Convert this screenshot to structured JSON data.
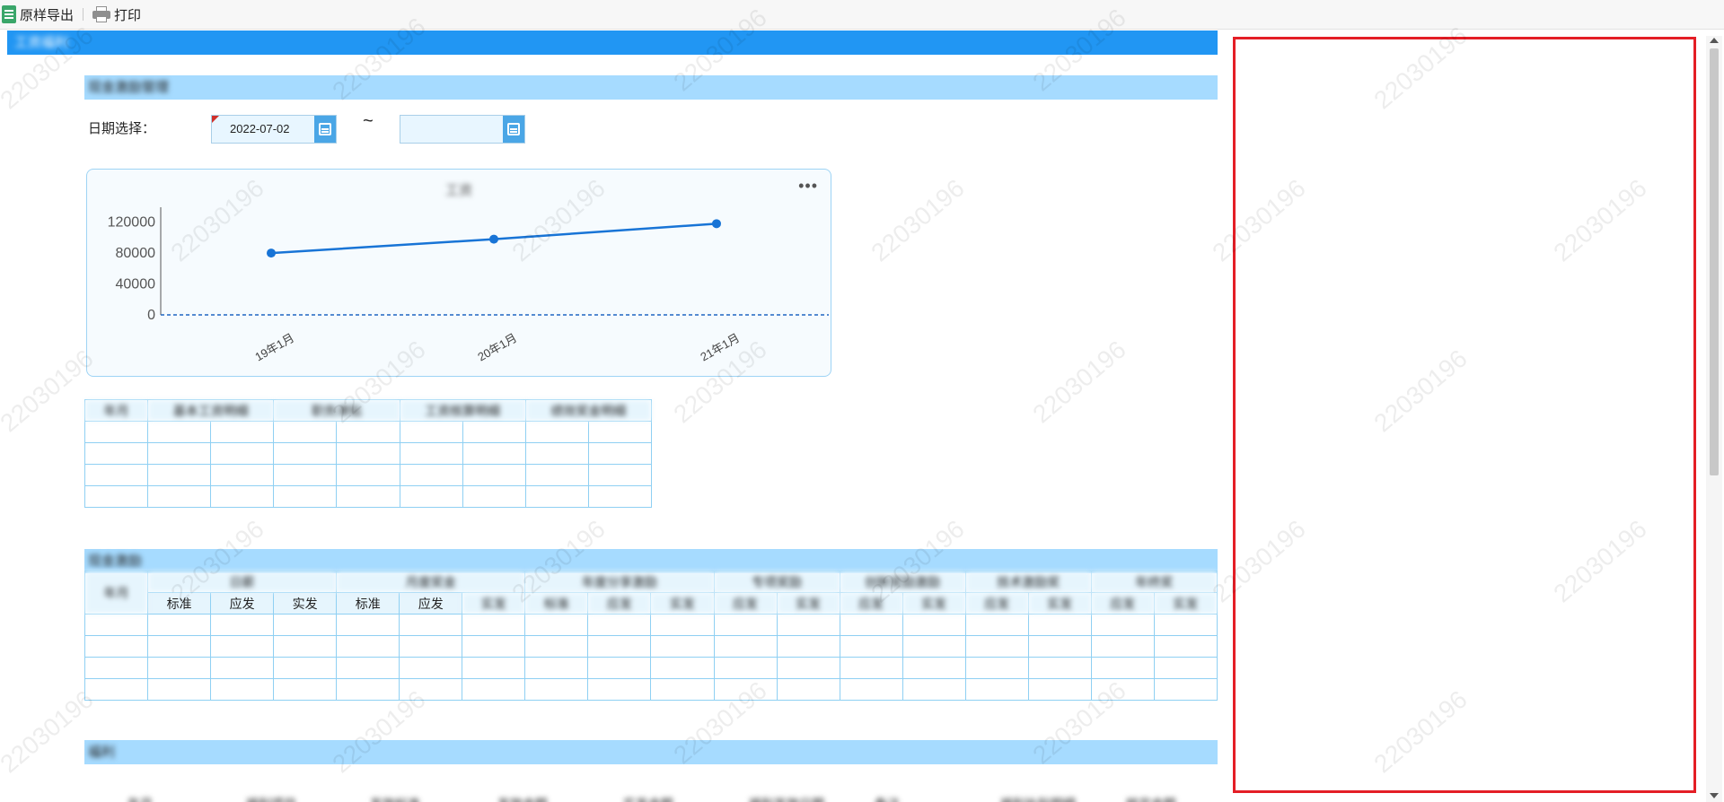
{
  "toolbar": {
    "export_label": "原样导出",
    "print_label": "打印"
  },
  "report": {
    "main_title": "工资福利",
    "section1_title": "现金激励管理",
    "date_label": "日期选择：",
    "date_start": "2022-07-02",
    "date_end": "",
    "tilde": "~",
    "section2_title": "现金激励",
    "section3_title": "福利"
  },
  "chart_data": {
    "type": "line",
    "title": "工资",
    "categories": [
      "19年1月",
      "20年1月",
      "21年1月"
    ],
    "values": [
      80000,
      98000,
      118000
    ],
    "yticks": [
      0,
      40000,
      80000,
      120000
    ],
    "ylim": [
      0,
      130000
    ],
    "grid": false,
    "color": "#1874d6"
  },
  "table1": {
    "headers": [
      "年月",
      "基本工资明细",
      "",
      "职务津贴",
      "",
      "工资核算明细",
      "",
      "绩效奖金明细",
      ""
    ],
    "rows": [
      [
        "",
        "",
        "",
        "",
        "",
        "",
        "",
        "",
        ""
      ],
      [
        "",
        "",
        "",
        "",
        "",
        "",
        "",
        "",
        ""
      ],
      [
        "",
        "",
        "",
        "",
        "",
        "",
        "",
        "",
        ""
      ],
      [
        "",
        "",
        "",
        "",
        "",
        "",
        "",
        "",
        ""
      ]
    ]
  },
  "table2": {
    "row_header": "年月",
    "group_headers": [
      "日薪",
      "月度奖金",
      "年度分享激励",
      "专项奖励",
      "创新奖励激励",
      "技术激励奖",
      "年终奖"
    ],
    "sub_headers": [
      "标准",
      "应发",
      "实发",
      "标准",
      "应发",
      "实发",
      "标准",
      "应发",
      "实发",
      "应发",
      "实发",
      "应发",
      "实发",
      "应发",
      "实发",
      "应发",
      "实发"
    ],
    "rows": [
      [
        "",
        "",
        "",
        "",
        "",
        "",
        "",
        "",
        "",
        "",
        "",
        "",
        "",
        "",
        "",
        "",
        "",
        ""
      ],
      [
        "",
        "",
        "",
        "",
        "",
        "",
        "",
        "",
        "",
        "",
        "",
        "",
        "",
        "",
        "",
        "",
        "",
        ""
      ],
      [
        "",
        "",
        "",
        "",
        "",
        "",
        "",
        "",
        "",
        "",
        "",
        "",
        "",
        "",
        "",
        "",
        "",
        ""
      ],
      [
        "",
        "",
        "",
        "",
        "",
        "",
        "",
        "",
        "",
        "",
        "",
        "",
        "",
        "",
        "",
        "",
        "",
        ""
      ]
    ]
  },
  "table3": {
    "columns": [
      "年月",
      "福利项目",
      "发放标准",
      "发放金额",
      "实发金额",
      "福利发放日期",
      "备注",
      "福利补贴明细",
      "核定金额"
    ]
  },
  "watermark": "22030196",
  "colors": {
    "accent": "#2196f3",
    "section_bar": "#a6dbff",
    "highlight_border": "#e41e26",
    "table_border": "#8fd0f3"
  }
}
